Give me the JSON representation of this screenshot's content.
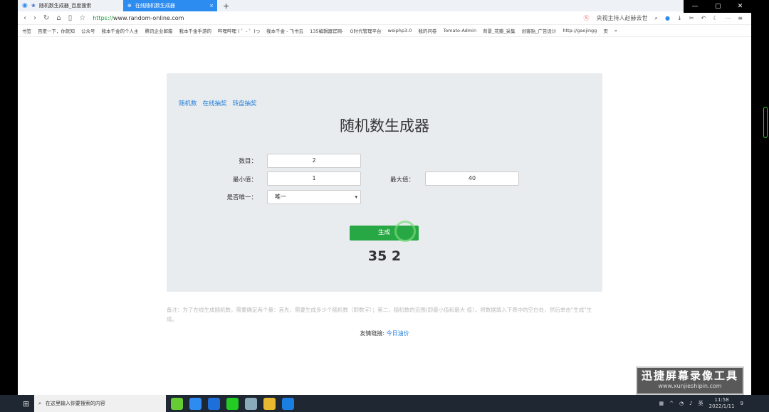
{
  "browser": {
    "tabs": [
      {
        "label": "随机数生成器_百度搜索",
        "active": false
      },
      {
        "label": "在线随机数生成器",
        "active": true
      }
    ],
    "new_tab": "+",
    "url_prefix": "https://",
    "url_host": "www.random-online.com",
    "search_hint": "央视主持人赵赫去世",
    "bookmarks": [
      "书签",
      "百度一下，你就知",
      "公众号",
      "我本千金的个人主",
      "腾讯企业邮箱",
      "我本千金手游的",
      "哔哩哔哩 ( ゜- ゜)つ",
      "我本千金 - 飞书云",
      "135编辑器官网-",
      "O时代管理平台",
      "weiphp3.0",
      "我的问卷",
      "Tomato-Admin",
      "背景_花瓣_采集",
      "创客贴_广告设计",
      "http://gaojingg",
      "页",
      "»"
    ]
  },
  "page": {
    "nav_links": [
      "随机数",
      "在线抽奖",
      "转盘抽奖"
    ],
    "title": "随机数生成器",
    "count_label": "数目：",
    "count_value": "2",
    "min_label": "最小值：",
    "min_value": "1",
    "max_label": "最大值：",
    "max_value": "40",
    "unique_label": "是否唯一：",
    "unique_value": "唯一",
    "generate_label": "生成",
    "result": "35 2",
    "note": "备注：为了在线生成随机数，需要确定两个量：首先，需要生成多少个随机数（即数字）；第二，随机数的范围(即最小值和最大 值）。将数据填入下表中的空白处，然后单击\"生成\"生成。",
    "friend_label": "友情链接:",
    "friend_link": "今日油价"
  },
  "watermark": {
    "title": "迅捷屏幕录像工具",
    "sub": "www.xunjieshipin.com"
  },
  "taskbar": {
    "search_placeholder": "在这里输入你要搜索的内容",
    "ime": "英",
    "time": "11:58",
    "date": "2022/1/11",
    "notif": "9"
  },
  "colors": {
    "accent": "#2d8cf0",
    "button": "#28a745",
    "link": "#2680d9"
  }
}
